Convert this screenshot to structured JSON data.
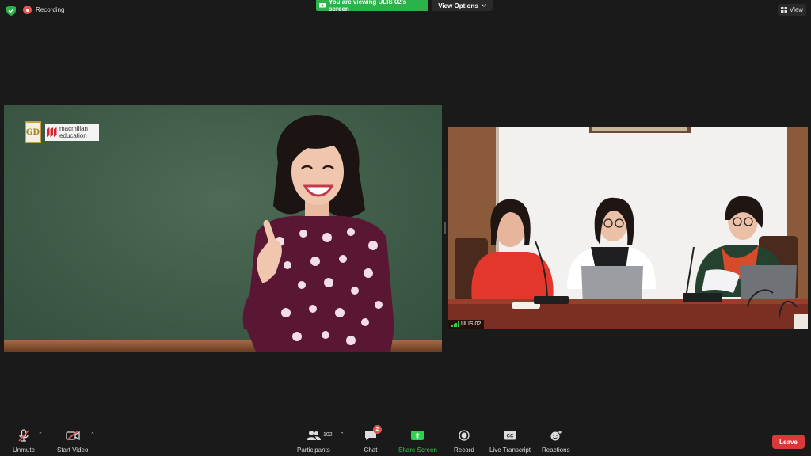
{
  "topbar": {
    "recording_label": "Recording",
    "share_banner": "You are viewing ULIS 02's screen",
    "view_options_label": "View Options",
    "view_label": "View"
  },
  "shared_screen": {
    "logo_gd": "GD",
    "logo_macmillan_line1": "macmillan",
    "logo_macmillan_line2": "education"
  },
  "participant_video": {
    "name": "ULIS 02"
  },
  "toolbar": {
    "unmute_label": "Unmute",
    "start_video_label": "Start Video",
    "participants_label": "Participants",
    "participants_count": "102",
    "chat_label": "Chat",
    "chat_badge": "2",
    "share_screen_label": "Share Screen",
    "record_label": "Record",
    "live_transcript_label": "Live Transcript",
    "reactions_label": "Reactions",
    "leave_label": "Leave"
  },
  "colors": {
    "share_green": "#2bb24a",
    "leave_red": "#d83a3a",
    "recording_red": "#e8544e",
    "background": "#1a1a1a"
  }
}
